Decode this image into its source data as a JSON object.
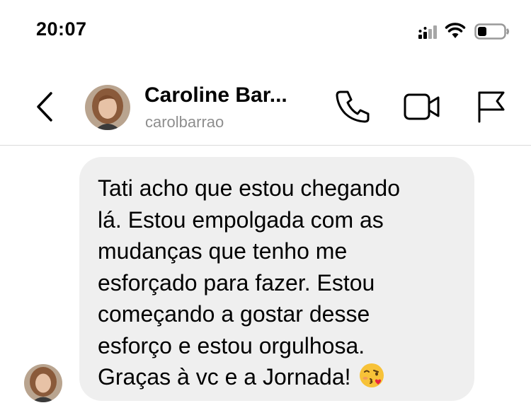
{
  "status_bar": {
    "time": "20:07",
    "icons": [
      "signal-icon",
      "wifi-icon",
      "battery-icon"
    ]
  },
  "header": {
    "contact_name": "Caroline Bar...",
    "contact_handle": "carolbarrao",
    "buttons": [
      "back-icon",
      "phone-icon",
      "video-icon",
      "flag-icon"
    ]
  },
  "message": {
    "text": "Tati acho que estou chegando\nlá. Estou empolgada com as\nmudanças que tenho me\nesforçado para fazer. Estou\ncomeçando a  gostar desse\nesforço e estou orgulhosa.\nGraças à vc e a Jornada!",
    "emoji": "kissing-face-with-heart-icon"
  },
  "colors": {
    "background": "#ffffff",
    "bubble": "#efefef",
    "handle_text": "#8e8e8e",
    "divider": "#dbdbdb"
  }
}
